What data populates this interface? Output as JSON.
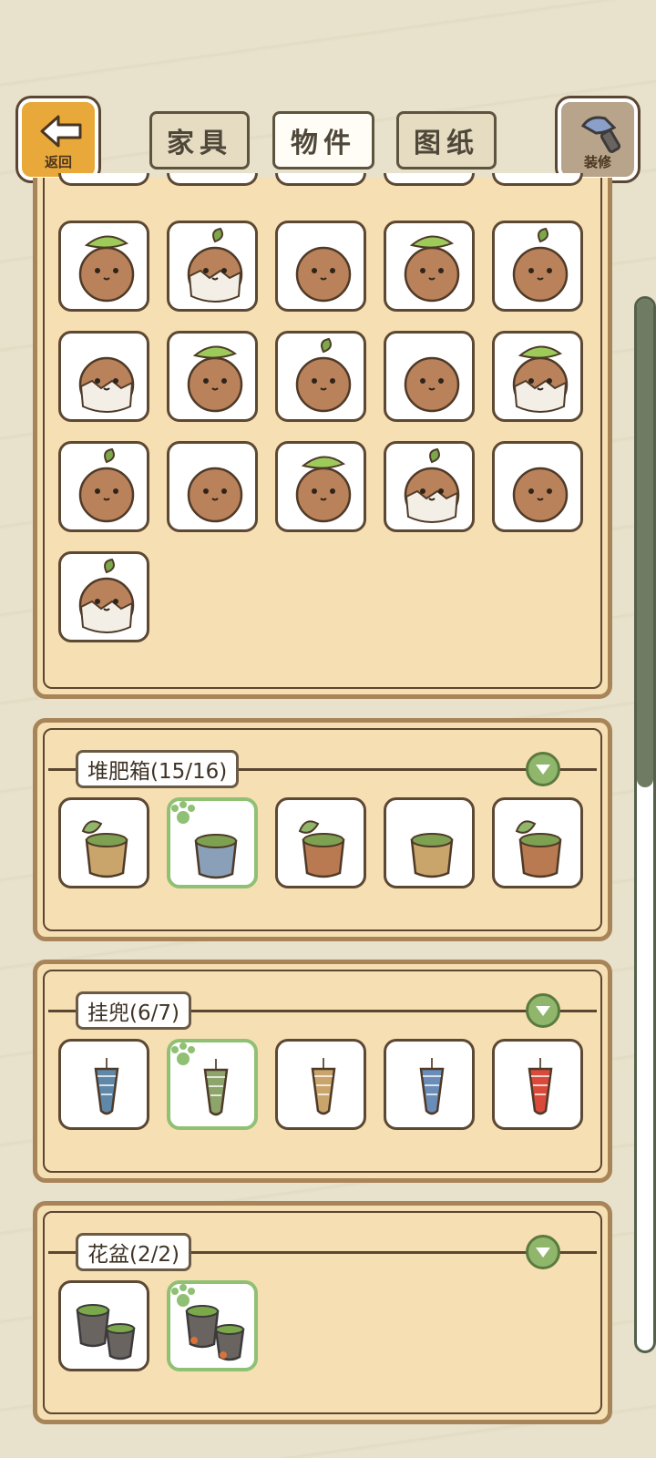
{
  "header": {
    "back_label": "返回",
    "decorate_label": "装修",
    "tabs": [
      {
        "label": "家具",
        "active": false
      },
      {
        "label": "物件",
        "active": true
      },
      {
        "label": "图纸",
        "active": false
      }
    ]
  },
  "sections": {
    "compost": {
      "title": "堆肥箱(15/16)"
    },
    "hanging": {
      "title": "挂兜(6/7)"
    },
    "pots": {
      "title": "花盆(2/2)"
    }
  },
  "colors": {
    "panel": "#f6dfb3",
    "panel_border": "#a88459",
    "selected": "#90c074",
    "background": "#e8e2cc"
  },
  "icons": {
    "back": "left-arrow-icon",
    "decorate": "paint-brush-icon",
    "collapse": "chevron-down-icon",
    "owned": "frog-paw-icon"
  }
}
